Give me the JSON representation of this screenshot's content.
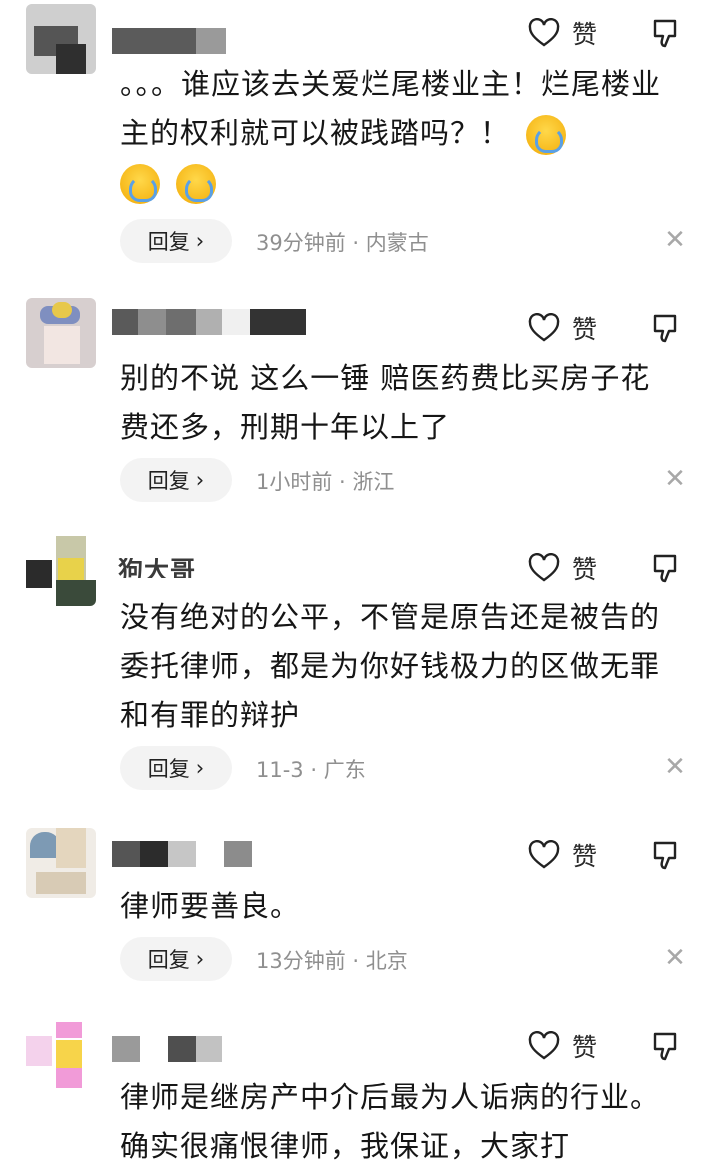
{
  "like_label": "赞",
  "reply_label": "回复",
  "comments": [
    {
      "name": "",
      "text": "。。。谁应该去关爱烂尾楼业主！烂尾楼业主的权利就可以被践踏吗？！",
      "emoji_count": 3,
      "time": "39分钟前",
      "location": "内蒙古"
    },
    {
      "name": "",
      "text": "别的不说 这么一锤 赔医药费比买房子花费还多，刑期十年以上了",
      "emoji_count": 0,
      "time": "1小时前",
      "location": "浙江"
    },
    {
      "name": "狗大哥",
      "text": "没有绝对的公平，不管是原告还是被告的委托律师，都是为你好钱极力的区做无罪和有罪的辩护",
      "emoji_count": 0,
      "time": "11-3",
      "location": "广东"
    },
    {
      "name": "",
      "text": "律师要善良。",
      "emoji_count": 0,
      "time": "13分钟前",
      "location": "北京"
    },
    {
      "name": "",
      "text": "律师是继房产中介后最为人诟病的行业。确实很痛恨律师，我保证，大家打",
      "emoji_count": 0,
      "time": "",
      "location": ""
    }
  ],
  "meta_separator": " · "
}
